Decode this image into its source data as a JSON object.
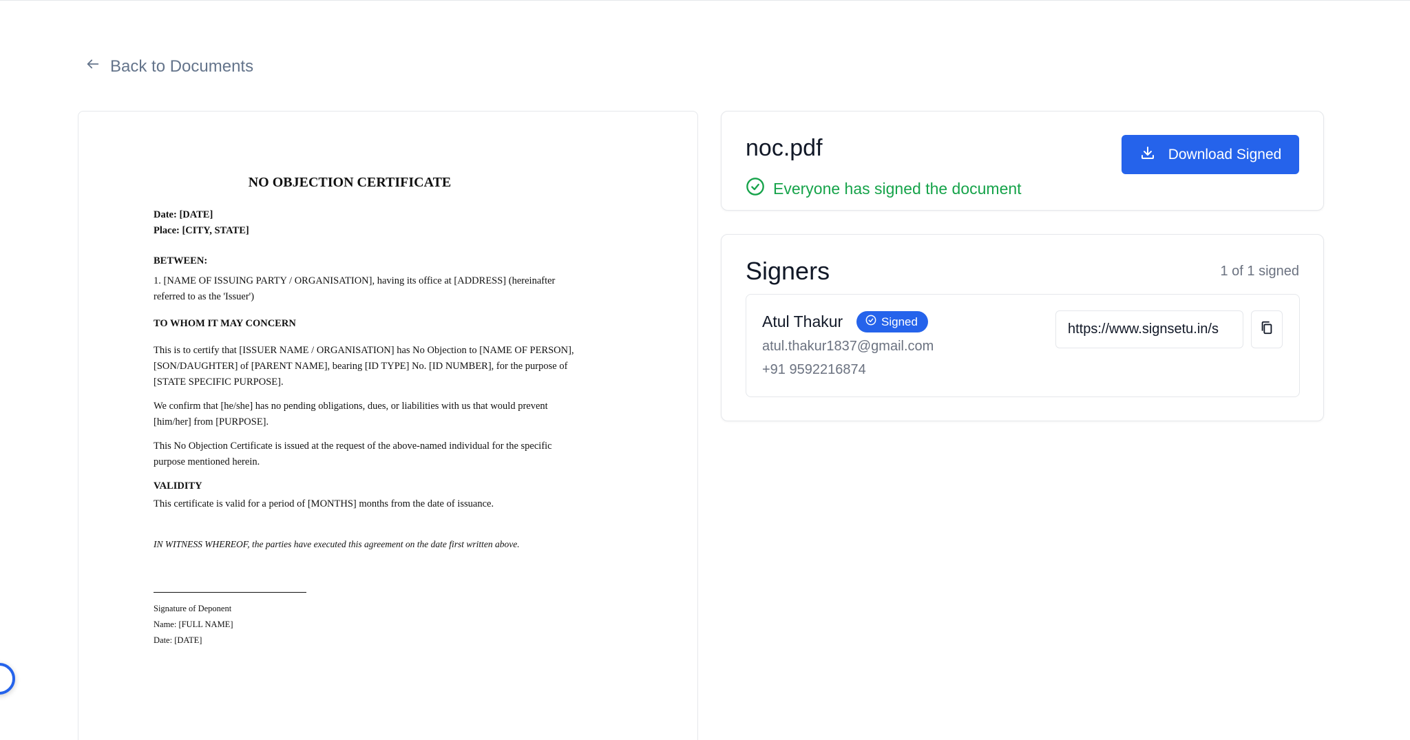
{
  "nav": {
    "back_label": "Back to Documents"
  },
  "document": {
    "title": "NO OBJECTION CERTIFICATE",
    "date_line": "Date: [DATE]",
    "place_line": "Place: [CITY, STATE]",
    "between_heading": "BETWEEN:",
    "party_line1": "1. [NAME OF ISSUING PARTY / ORGANISATION], having its office at [ADDRESS] (hereinafter",
    "party_line2": "referred to as the 'Issuer')",
    "concern_heading": "TO WHOM IT MAY CONCERN",
    "para1_line1": "This is to certify that [ISSUER NAME / ORGANISATION] has No Objection to [NAME OF PERSON],",
    "para1_line2": "[SON/DAUGHTER] of [PARENT NAME], bearing [ID TYPE] No. [ID NUMBER], for the purpose of",
    "para1_line3": "[STATE SPECIFIC PURPOSE].",
    "para2_line1": "We confirm that [he/she] has no pending obligations, dues, or liabilities with us that would prevent",
    "para2_line2": "[him/her] from [PURPOSE].",
    "para3_line1": "This No Objection Certificate is issued at the request of the above-named individual for the specific",
    "para3_line2": "purpose mentioned herein.",
    "validity_heading": "VALIDITY",
    "validity_text": "This certificate is valid for a period of [MONTHS] months from the date of issuance.",
    "witness_text": "IN WITNESS WHEREOF, the parties have executed this agreement on the date first written above.",
    "sig_label": "Signature of Deponent",
    "sig_name": "Name: [FULL NAME]",
    "sig_date": "Date: [DATE]"
  },
  "info": {
    "file_name": "noc.pdf",
    "status_text": "Everyone has signed the document",
    "download_label": "Download Signed"
  },
  "signers": {
    "title": "Signers",
    "count_text": "1 of 1 signed",
    "items": [
      {
        "name": "Atul Thakur",
        "badge": "Signed",
        "email": "atul.thakur1837@gmail.com",
        "phone": "+91 9592216874",
        "link": "https://www.signsetu.in/s"
      }
    ]
  },
  "colors": {
    "accent": "#2563eb",
    "success": "#16a34a",
    "muted": "#6b7280",
    "border": "#e5e7eb"
  },
  "icons": {
    "back": "arrow-left-icon",
    "status": "check-circle-icon",
    "download": "download-icon",
    "badge": "check-circle-icon",
    "copy": "copy-icon"
  }
}
